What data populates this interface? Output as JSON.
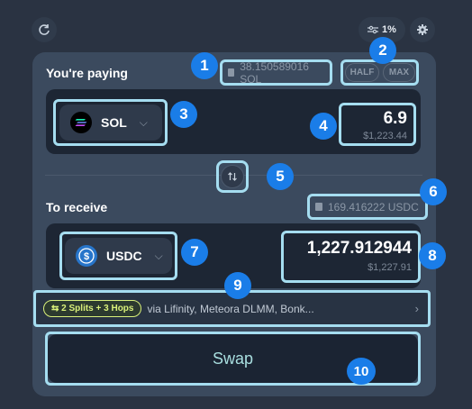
{
  "header": {
    "refresh_icon": "refresh-icon",
    "slippage_label": "1%",
    "slippage_icon": "sliders-icon",
    "settings_icon": "gear-icon"
  },
  "paying": {
    "label": "You're paying",
    "balance": "38.150589016 SOL",
    "half_label": "HALF",
    "max_label": "MAX",
    "token": "SOL",
    "amount": "6.9",
    "usd_value": "$1,223.44"
  },
  "receive": {
    "label": "To receive",
    "balance": "169.416222 USDC",
    "token": "USDC",
    "amount": "1,227.912944",
    "usd_value": "$1,227.91"
  },
  "route": {
    "badge": "2 Splits + 3 Hops",
    "via_text": "via Lifinity, Meteora DLMM, Bonk..."
  },
  "swap_label": "Swap",
  "markers": [
    "1",
    "2",
    "3",
    "4",
    "5",
    "6",
    "7",
    "8",
    "9",
    "10"
  ],
  "colors": {
    "background": "#2a3342",
    "card": "#3b4a5e",
    "highlight": "#a5ddf0",
    "marker": "#1a7de8",
    "route_badge": "#d9f07a",
    "swap_text": "#a9dfe0"
  }
}
